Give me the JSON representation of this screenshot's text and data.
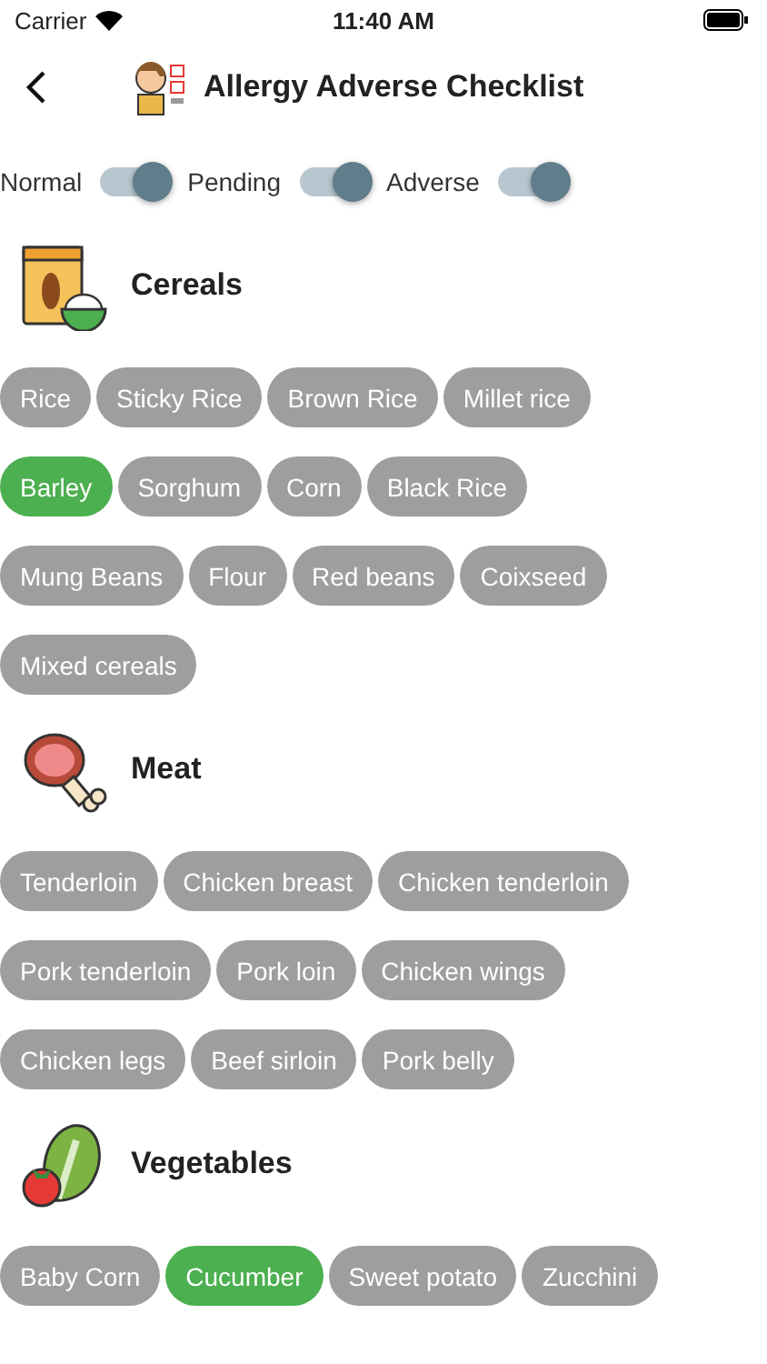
{
  "status_bar": {
    "carrier": "Carrier",
    "time": "11:40 AM"
  },
  "nav": {
    "title": "Allergy Adverse Checklist"
  },
  "filters": [
    {
      "label": "Normal",
      "on": true
    },
    {
      "label": "Pending",
      "on": true
    },
    {
      "label": "Adverse",
      "on": true
    }
  ],
  "sections": [
    {
      "kind": "cereals",
      "title": "Cereals",
      "items": [
        {
          "label": "Rice",
          "selected": false
        },
        {
          "label": "Sticky Rice",
          "selected": false
        },
        {
          "label": "Brown Rice",
          "selected": false
        },
        {
          "label": "Millet rice",
          "selected": false
        },
        {
          "label": "Barley",
          "selected": true
        },
        {
          "label": "Sorghum",
          "selected": false
        },
        {
          "label": "Corn",
          "selected": false
        },
        {
          "label": "Black Rice",
          "selected": false
        },
        {
          "label": "Mung Beans",
          "selected": false
        },
        {
          "label": "Flour",
          "selected": false
        },
        {
          "label": "Red beans",
          "selected": false
        },
        {
          "label": "Coixseed",
          "selected": false
        },
        {
          "label": "Mixed cereals",
          "selected": false
        }
      ]
    },
    {
      "kind": "meat",
      "title": "Meat",
      "items": [
        {
          "label": "Tenderloin",
          "selected": false
        },
        {
          "label": "Chicken breast",
          "selected": false
        },
        {
          "label": "Chicken tenderloin",
          "selected": false
        },
        {
          "label": "Pork tenderloin",
          "selected": false
        },
        {
          "label": "Pork loin",
          "selected": false
        },
        {
          "label": "Chicken wings",
          "selected": false
        },
        {
          "label": "Chicken legs",
          "selected": false
        },
        {
          "label": "Beef sirloin",
          "selected": false
        },
        {
          "label": "Pork belly",
          "selected": false
        }
      ]
    },
    {
      "kind": "vegetables",
      "title": "Vegetables",
      "items": [
        {
          "label": "Baby Corn",
          "selected": false
        },
        {
          "label": "Cucumber",
          "selected": true
        },
        {
          "label": "Sweet potato",
          "selected": false
        },
        {
          "label": "Zucchini",
          "selected": false
        }
      ]
    }
  ]
}
